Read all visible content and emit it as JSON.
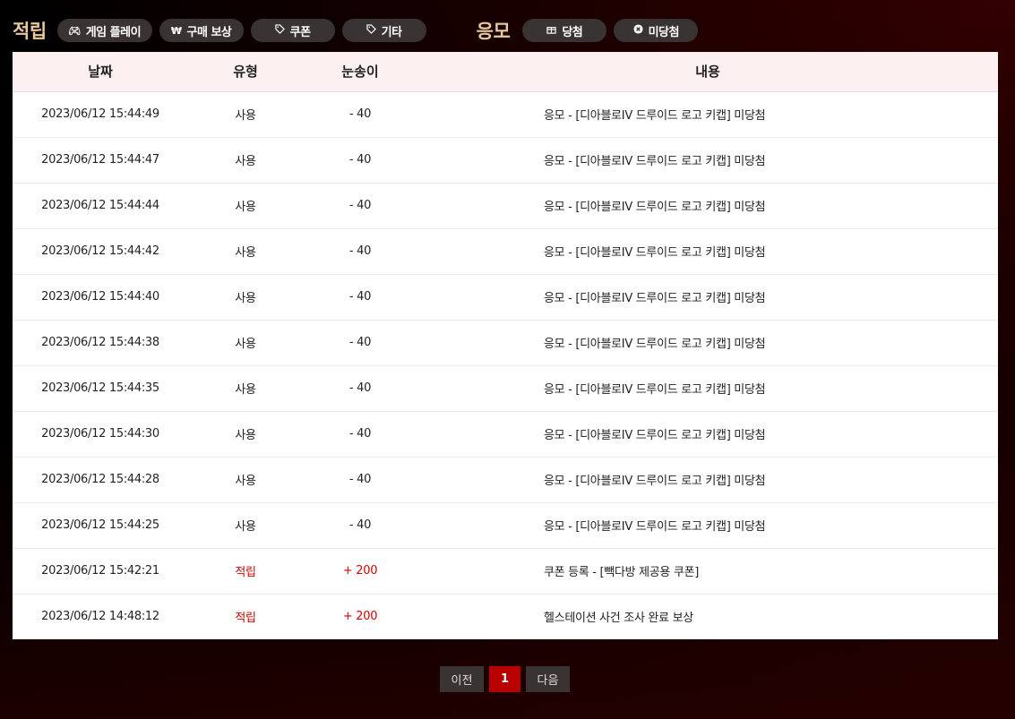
{
  "filters": {
    "earn_title": "적립",
    "earn_buttons": [
      {
        "label": "게임 플레이",
        "icon": "gamepad-icon"
      },
      {
        "label": "구매 보상",
        "icon": "won-icon"
      },
      {
        "label": "쿠폰",
        "icon": "tag-icon"
      },
      {
        "label": "기타",
        "icon": "tag-icon"
      }
    ],
    "apply_title": "응모",
    "apply_buttons": [
      {
        "label": "당첨",
        "icon": "gift-icon"
      },
      {
        "label": "미당첨",
        "icon": "x-circle-icon"
      }
    ]
  },
  "table": {
    "headers": [
      "날짜",
      "유형",
      "눈송이",
      "내용"
    ],
    "rows": [
      {
        "date": "2023/06/12 15:44:49",
        "type": "사용",
        "amount": "- 40",
        "content": "응모 - [디아블로IV 드루이드 로고 키캡] 미당첨",
        "earn": false
      },
      {
        "date": "2023/06/12 15:44:47",
        "type": "사용",
        "amount": "- 40",
        "content": "응모 - [디아블로IV 드루이드 로고 키캡] 미당첨",
        "earn": false
      },
      {
        "date": "2023/06/12 15:44:44",
        "type": "사용",
        "amount": "- 40",
        "content": "응모 - [디아블로IV 드루이드 로고 키캡] 미당첨",
        "earn": false
      },
      {
        "date": "2023/06/12 15:44:42",
        "type": "사용",
        "amount": "- 40",
        "content": "응모 - [디아블로IV 드루이드 로고 키캡] 미당첨",
        "earn": false
      },
      {
        "date": "2023/06/12 15:44:40",
        "type": "사용",
        "amount": "- 40",
        "content": "응모 - [디아블로IV 드루이드 로고 키캡] 미당첨",
        "earn": false
      },
      {
        "date": "2023/06/12 15:44:38",
        "type": "사용",
        "amount": "- 40",
        "content": "응모 - [디아블로IV 드루이드 로고 키캡] 미당첨",
        "earn": false
      },
      {
        "date": "2023/06/12 15:44:35",
        "type": "사용",
        "amount": "- 40",
        "content": "응모 - [디아블로IV 드루이드 로고 키캡] 미당첨",
        "earn": false
      },
      {
        "date": "2023/06/12 15:44:30",
        "type": "사용",
        "amount": "- 40",
        "content": "응모 - [디아블로IV 드루이드 로고 키캡] 미당첨",
        "earn": false
      },
      {
        "date": "2023/06/12 15:44:28",
        "type": "사용",
        "amount": "- 40",
        "content": "응모 - [디아블로IV 드루이드 로고 키캡] 미당첨",
        "earn": false
      },
      {
        "date": "2023/06/12 15:44:25",
        "type": "사용",
        "amount": "- 40",
        "content": "응모 - [디아블로IV 드루이드 로고 키캡] 미당첨",
        "earn": false
      },
      {
        "date": "2023/06/12 15:42:21",
        "type": "적립",
        "amount": "+ 200",
        "content": "쿠폰 등록 - [빽다방 제공용 쿠폰]",
        "earn": true
      },
      {
        "date": "2023/06/12 14:48:12",
        "type": "적립",
        "amount": "+ 200",
        "content": "헬스테이션 사건 조사 완료 보상",
        "earn": true
      }
    ]
  },
  "pagination": {
    "prev": "이전",
    "current": "1",
    "next": "다음"
  },
  "colors": {
    "accent": "#b80000",
    "earn_text": "#d40000",
    "title_gold": "#e7c99b"
  }
}
